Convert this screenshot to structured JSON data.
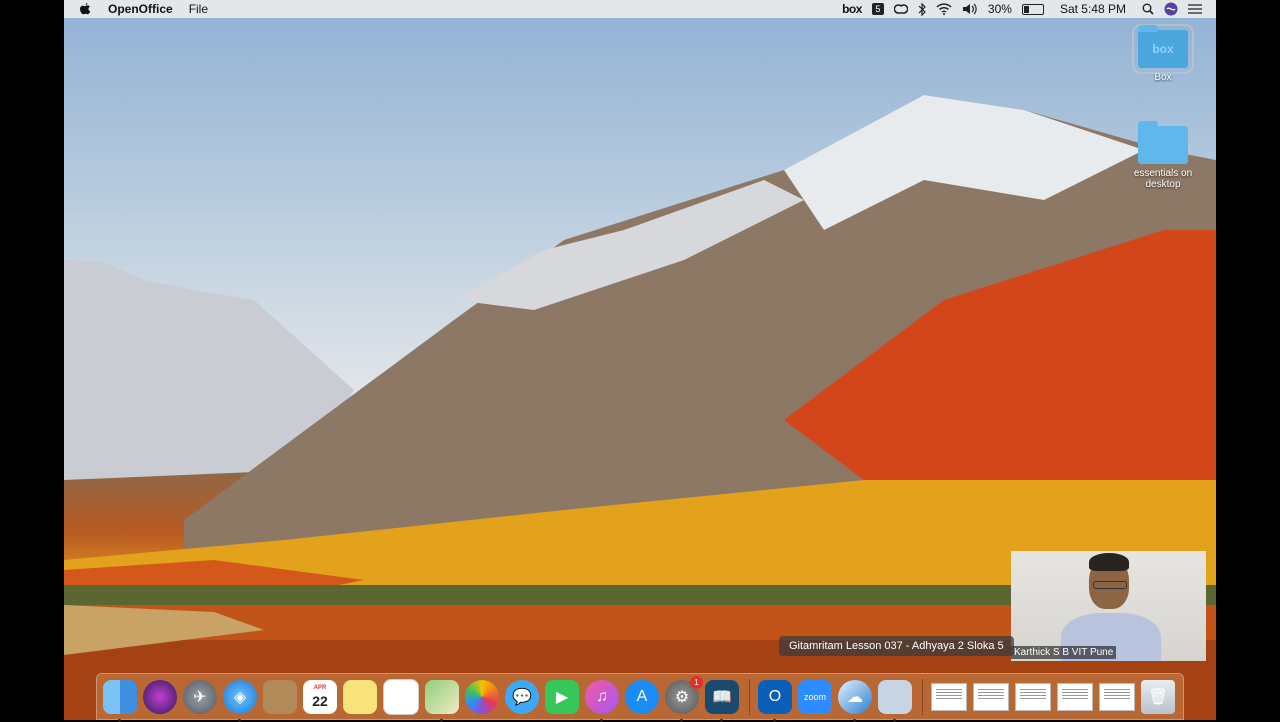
{
  "menubar": {
    "app_name": "OpenOffice",
    "menus": [
      "File"
    ],
    "status": {
      "box_label": "box",
      "battery_percent": "30%",
      "battery_level": 0.3,
      "clock": "Sat 5:48 PM"
    }
  },
  "desktop_icons": [
    {
      "label": "Box",
      "folder_text": "box"
    },
    {
      "label": "essentials on desktop"
    }
  ],
  "video": {
    "participant_name": "Karthick S B VIT Pune"
  },
  "tooltip": {
    "text": "Gitamritam Lesson 037 - Adhyaya 2 Sloka 5"
  },
  "dock": {
    "calendar": {
      "month": "APR",
      "day": "22"
    },
    "app_store_badge": "1",
    "zoom_label": "zoom",
    "apps": [
      "finder-icon",
      "siri-icon",
      "launchpad-icon",
      "safari-icon",
      "contacts-icon",
      "calendar-icon",
      "notes-icon",
      "reminders-icon",
      "maps-icon",
      "photos-icon",
      "messages-icon",
      "facetime-icon",
      "itunes-icon",
      "app-store-icon",
      "system-preferences-icon",
      "kindle-icon",
      "outlook-icon",
      "zoom-icon",
      "openoffice-icon",
      "preview-icon"
    ]
  }
}
